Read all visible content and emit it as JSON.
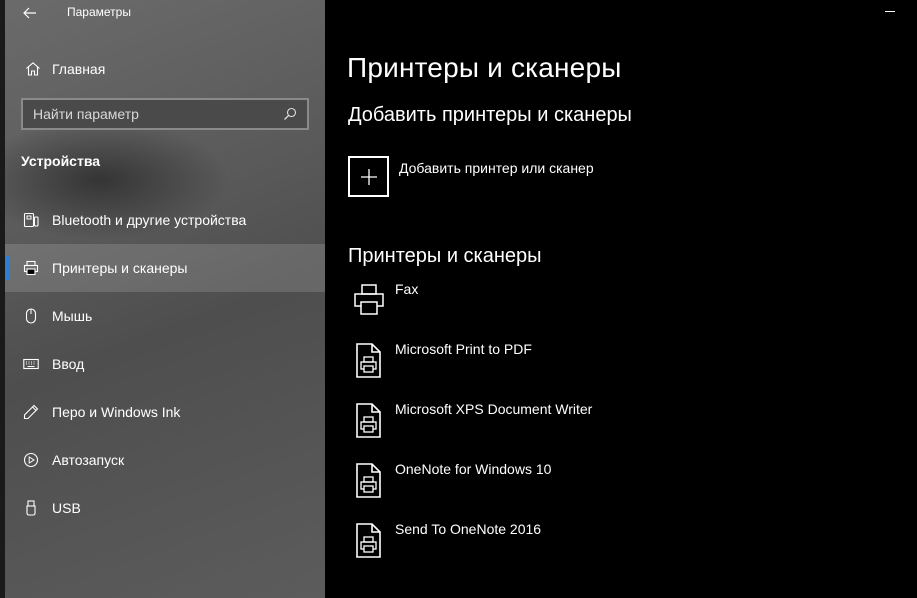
{
  "window": {
    "title": "Параметры"
  },
  "nav": {
    "home_label": "Главная",
    "search_placeholder": "Найти параметр",
    "section_title": "Устройства",
    "items": [
      {
        "label": "Bluetooth и другие устройства",
        "icon": "bluetooth-devices-icon",
        "active": false
      },
      {
        "label": "Принтеры и сканеры",
        "icon": "printer-icon",
        "active": true
      },
      {
        "label": "Мышь",
        "icon": "mouse-icon",
        "active": false
      },
      {
        "label": "Ввод",
        "icon": "keyboard-icon",
        "active": false
      },
      {
        "label": "Перо и Windows Ink",
        "icon": "pen-icon",
        "active": false
      },
      {
        "label": "Автозапуск",
        "icon": "autoplay-icon",
        "active": false
      },
      {
        "label": "USB",
        "icon": "usb-icon",
        "active": false
      }
    ]
  },
  "main": {
    "page_title": "Принтеры и сканеры",
    "add_section_title": "Добавить принтеры и сканеры",
    "add_button_label": "Добавить принтер или сканер",
    "list_section_title": "Принтеры и сканеры",
    "printers": [
      {
        "name": "Fax",
        "icon": "fax-printer-icon"
      },
      {
        "name": "Microsoft Print to PDF",
        "icon": "document-printer-icon"
      },
      {
        "name": "Microsoft XPS Document Writer",
        "icon": "document-printer-icon"
      },
      {
        "name": "OneNote for Windows 10",
        "icon": "document-printer-icon"
      },
      {
        "name": "Send To OneNote 2016",
        "icon": "document-printer-icon"
      }
    ]
  },
  "colors": {
    "accent": "#2d7fd3",
    "content_bg": "#000000",
    "nav_bg": "#5e5e5e"
  }
}
